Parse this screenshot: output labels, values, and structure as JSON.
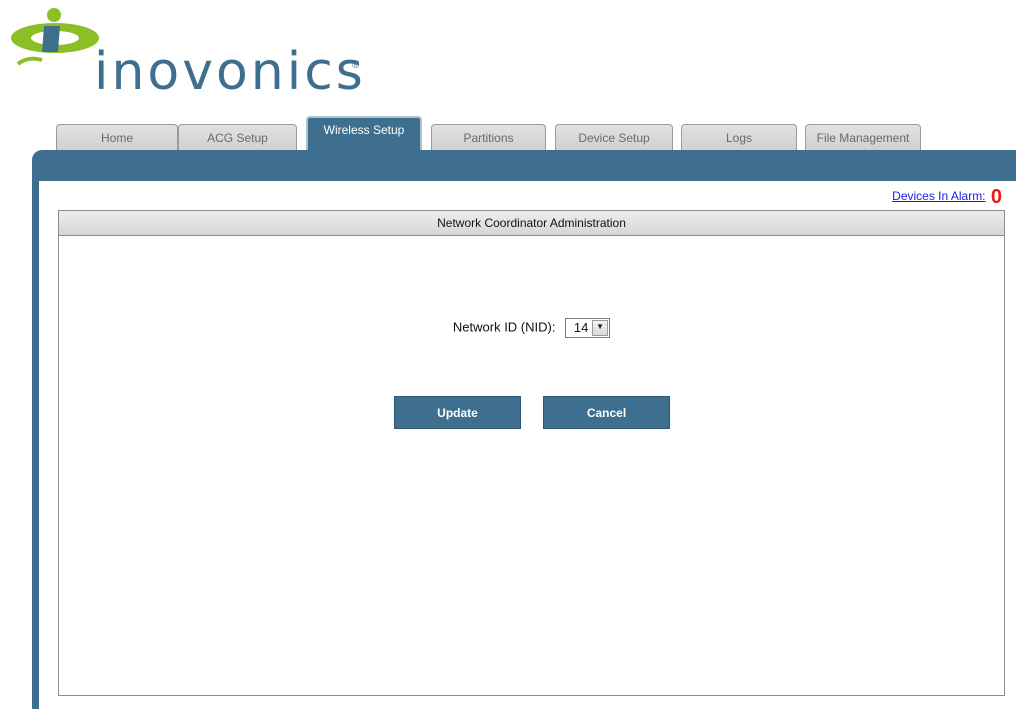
{
  "brand": {
    "name": "inovonics",
    "registered_mark": "®",
    "colors": {
      "primary": "#3e6f8e",
      "accent": "#8cbf26",
      "alarm": "#e21b1b",
      "link": "#1a1aee"
    }
  },
  "tabs": [
    {
      "label": "Home",
      "active": false
    },
    {
      "label": "ACG Setup",
      "active": false
    },
    {
      "label": "Wireless Setup",
      "active": true
    },
    {
      "label": "Partitions",
      "active": false
    },
    {
      "label": "Device Setup",
      "active": false
    },
    {
      "label": "Logs",
      "active": false
    },
    {
      "label": "File Management",
      "active": false
    }
  ],
  "alarm": {
    "label": "Devices In Alarm:",
    "count": "0"
  },
  "panel": {
    "title": "Network Coordinator Administration"
  },
  "form": {
    "nid_label": "Network ID (NID):",
    "nid_value": "14",
    "nid_arrow_icon": "dropdown-arrow-icon"
  },
  "buttons": {
    "update": "Update",
    "cancel": "Cancel"
  }
}
